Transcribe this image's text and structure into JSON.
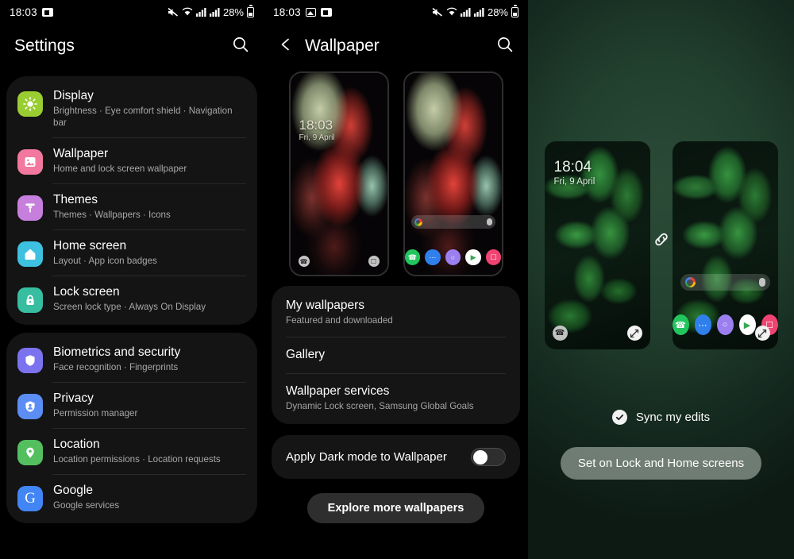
{
  "panels": {
    "settings": {
      "status_bar": {
        "time": "18:03",
        "battery": "28%",
        "icons": [
          "screenshot-icon",
          "mute-icon",
          "wifi-icon",
          "signal-icon",
          "signal-icon",
          "battery-icon"
        ]
      },
      "app_bar": {
        "title": "Settings",
        "search_icon": "search-icon"
      },
      "groups": [
        {
          "items": [
            {
              "title": "Display",
              "subtitle": "Brightness  ·  Eye comfort shield  ·  Navigation bar",
              "icon": "brightness-icon",
              "color": "#9acd32"
            },
            {
              "title": "Wallpaper",
              "subtitle": "Home and lock screen wallpaper",
              "icon": "image-icon",
              "color": "#f2789f"
            },
            {
              "title": "Themes",
              "subtitle": "Themes  ·  Wallpapers  ·  Icons",
              "icon": "paint-roller-icon",
              "color": "#c77fdd"
            },
            {
              "title": "Home screen",
              "subtitle": "Layout  ·  App icon badges",
              "icon": "home-icon",
              "color": "#3ec1e0"
            },
            {
              "title": "Lock screen",
              "subtitle": "Screen lock type  ·  Always On Display",
              "icon": "lock-icon",
              "color": "#37bda0"
            }
          ]
        },
        {
          "items": [
            {
              "title": "Biometrics and security",
              "subtitle": "Face recognition  ·  Fingerprints",
              "icon": "shield-icon",
              "color": "#7b72f0"
            },
            {
              "title": "Privacy",
              "subtitle": "Permission manager",
              "icon": "privacy-shield-icon",
              "color": "#5b8df5"
            },
            {
              "title": "Location",
              "subtitle": "Location permissions  ·  Location requests",
              "icon": "location-pin-icon",
              "color": "#53bf5f"
            },
            {
              "title": "Google",
              "subtitle": "Google services",
              "icon": "google-g-icon",
              "color": "#4285f4"
            }
          ]
        }
      ]
    },
    "wallpaper": {
      "status_bar": {
        "time": "18:03",
        "battery": "28%"
      },
      "app_bar": {
        "title": "Wallpaper",
        "back_icon": "back-chevron-icon",
        "search_icon": "search-icon"
      },
      "previews": [
        {
          "type": "lock-screen",
          "clock": "18:03",
          "date": "Fri, 9 April",
          "left_shortcut": "phone-icon",
          "right_shortcut": "camera-icon"
        },
        {
          "type": "home-screen",
          "search_placeholder": "",
          "dock": [
            "phone-icon",
            "messages-icon",
            "internet-icon",
            "play-store-icon",
            "camera-icon"
          ]
        }
      ],
      "options": [
        {
          "title": "My wallpapers",
          "subtitle": "Featured and downloaded"
        },
        {
          "title": "Gallery",
          "subtitle": ""
        },
        {
          "title": "Wallpaper services",
          "subtitle": "Dynamic Lock screen, Samsung Global Goals"
        }
      ],
      "toggle": {
        "label": "Apply Dark mode to Wallpaper",
        "state": "off"
      },
      "explore_button": "Explore more wallpapers"
    },
    "preview": {
      "lock": {
        "clock": "18:04",
        "date": "Fri, 9 April",
        "left_shortcut": "phone-icon",
        "right_shortcut": "expand-icon"
      },
      "home": {
        "dock": [
          "phone-icon",
          "messages-icon",
          "internet-icon",
          "play-store-icon",
          "camera-icon"
        ],
        "right_shortcut": "expand-icon"
      },
      "link_icon": "link-icon",
      "sync": {
        "label": "Sync my edits",
        "icon": "check-circle-icon",
        "checked": true
      },
      "set_button": "Set on Lock and Home screens"
    }
  },
  "colors": {
    "accent_green": "#2b4b37",
    "card_bg": "#141414",
    "text_primary": "#ffffff",
    "text_secondary": "#a8a8a8"
  }
}
